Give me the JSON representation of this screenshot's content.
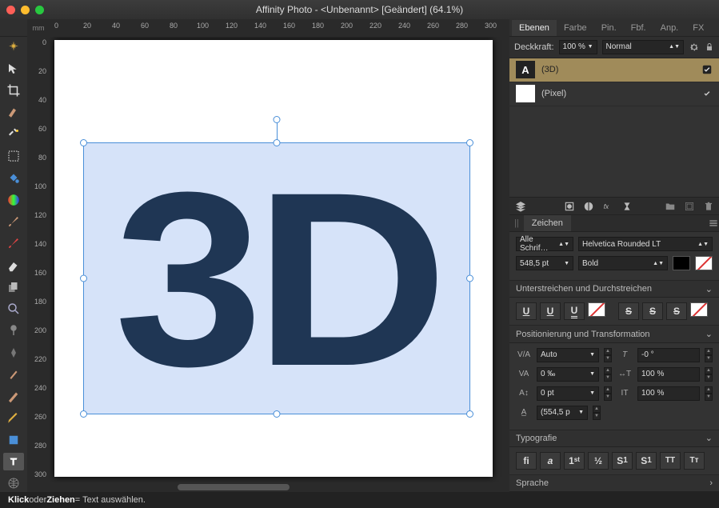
{
  "window": {
    "title": "Affinity Photo - <Unbenannt> [Geändert] (64.1%)"
  },
  "top_tabs": [
    "Ebenen",
    "Farbe",
    "Pin.",
    "Fbf.",
    "Anp.",
    "FX"
  ],
  "top_tab_active": 0,
  "ruler_unit": "mm",
  "ruler_h": [
    "0",
    "20",
    "40",
    "60",
    "80",
    "100",
    "120",
    "140",
    "160",
    "180",
    "200",
    "220",
    "240",
    "260",
    "280",
    "300"
  ],
  "ruler_v": [
    "0",
    "20",
    "40",
    "60",
    "80",
    "100",
    "120",
    "140",
    "160",
    "180",
    "200",
    "220",
    "240",
    "260",
    "280",
    "300"
  ],
  "canvas_text": "3D",
  "opacity": {
    "label": "Deckkraft:",
    "value": "100 %",
    "blend": "Normal"
  },
  "layers": [
    {
      "name": "(3D)",
      "type": "text",
      "selected": true
    },
    {
      "name": "(Pixel)",
      "type": "pixel",
      "selected": false
    }
  ],
  "char_panel": {
    "tab": "Zeichen",
    "font_filter": "Alle Schrif…",
    "font_family": "Helvetica Rounded LT",
    "font_size": "548,5 pt",
    "font_weight": "Bold",
    "sect_underline": "Unterstreichen und Durchstreichen",
    "sect_position": "Positionierung und Transformation",
    "kerning": "Auto",
    "tracking": "0 ‰",
    "baseline": "0 pt",
    "leading": "(554,5 p",
    "shear": "-0 °",
    "hscale": "100 %",
    "vscale": "100 %",
    "sect_typo": "Typografie",
    "sect_lang": "Sprache"
  },
  "status": {
    "a": "Klick",
    "mid": " oder ",
    "b": "Ziehen",
    "rest": " = Text auswählen."
  }
}
